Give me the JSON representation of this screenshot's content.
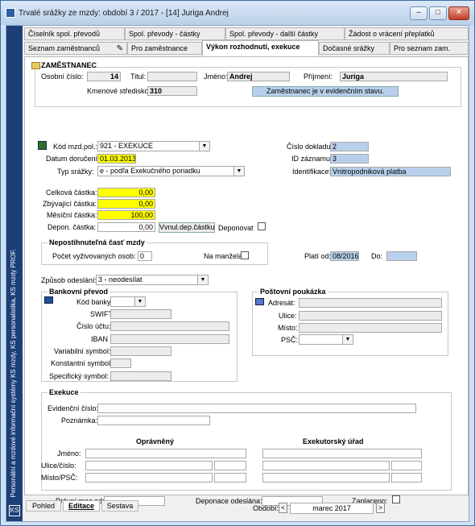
{
  "window": {
    "title": "Trvalé srážky ze mzdy: období 3 / 2017 - [14] Juriga Andrej",
    "btn_min": "–",
    "btn_max": "□",
    "btn_close": "✕"
  },
  "sidebar": {
    "text": "Personální a mzdové informační systémy KS mzdy, KS personalistika, KS mzdy PROF.",
    "logo": "KS"
  },
  "tabs": {
    "row1": [
      "Číselník spol. převodů",
      "Spol. převody - částky",
      "Spol. převody - další částky",
      "Žádost o vrácení přeplatků"
    ],
    "row2": [
      "Seznam zaměstnanců",
      "Pro zaměstnance",
      "Výkon rozhodnutí, exekuce",
      "Dočasné srážky",
      "Pro seznam zam."
    ]
  },
  "employee": {
    "section": "ZAMĚSTNANEC",
    "osobni_cislo_label": "Osobní číslo:",
    "osobni_cislo": "14",
    "titul_label": "Titul:",
    "titul": "",
    "jmeno_label": "Jméno:",
    "jmeno": "Andrej",
    "prijmeni_label": "Příjmení:",
    "prijmeni": "Juriga",
    "stredisko_label": "Kmenové středisko:",
    "stredisko": "310",
    "status_button": "Zaměstnanec je v evidenčním stavu."
  },
  "deduction": {
    "kod_label": "Kód mzd.pol.:",
    "kod": "921 - EXEKUCE",
    "datum_label": "Datum doručení:",
    "datum": "01.03.2013",
    "typ_label": "Typ srážky:",
    "typ": "e - podľa Exekučného poriadku",
    "cislo_dokladu_label": "Číslo dokladu:",
    "cislo_dokladu": "2",
    "id_label": "ID záznamu:",
    "id": "3",
    "identifikace_label": "Identifikace:",
    "identifikace": "Vnitropodniková platba",
    "celkova_label": "Celková částka:",
    "celkova": "0,00",
    "zbyvajici_label": "Zbývající částka:",
    "zbyvajici": "0,00",
    "mesicni_label": "Měsíční částka:",
    "mesicni": "100,00",
    "depon_label": "Depon. částka:",
    "depon": "0,00",
    "vynul_button": "Vvnul.dep.částku",
    "deponovat_label": "Deponovat"
  },
  "nepostizitelna": {
    "title": "Nepostihnuteľná časť mzdy",
    "pocet_label": "Počet vyživovaných osob:",
    "pocet": "0",
    "manzela_label": "Na manžela",
    "plati_od_label": "Platí od:",
    "plati_od": "08/2016",
    "do_label": "Do:",
    "do": ""
  },
  "zpusob": {
    "label": "Způsob odeslání:",
    "value": "3 - neodesílat"
  },
  "bank": {
    "title": "Bankovní převod",
    "kod_banky": "Kód banky:",
    "swift": "SWIFT :",
    "cislo_uctu": "Číslo účtu:",
    "iban": "IBAN :",
    "var": "Variabilní symbol:",
    "konst": "Konstantní symbol:",
    "spec": "Specifický symbol:"
  },
  "postal": {
    "title": "Poštovní poukázka",
    "adresat": "Adresát:",
    "ulice": "Ulice:",
    "misto": "Místo:",
    "psc": "PSČ:"
  },
  "exekuce": {
    "title": "Exekuce",
    "evidencni": "Evidenční číslo:",
    "poznamka": "Poznámka:",
    "opravneny": "Oprávněný",
    "urad": "Exekutorský úřad",
    "jmeno": "Jméno:",
    "ulice": "Ulice/číslo:",
    "misto": "Místo/PSČ:",
    "pravni_moc": "Právní moc od:",
    "deponace": "Deponace odeslána:",
    "zaplaceno": "Zaplaceno:"
  },
  "bottom": {
    "tabs": [
      "Pohled",
      "Editace",
      "Sestava"
    ],
    "obdobi_label": "Období:",
    "obdobi": "marec 2017",
    "prev": "<",
    "next": ">"
  }
}
